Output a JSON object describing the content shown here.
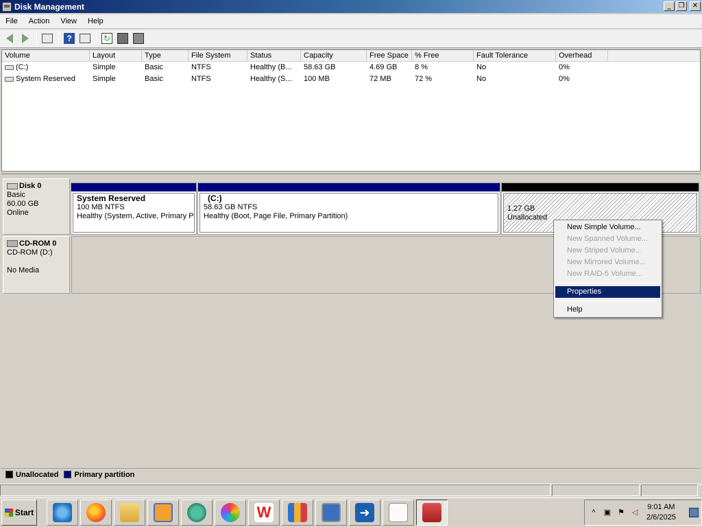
{
  "window": {
    "title": "Disk Management"
  },
  "menu": [
    "File",
    "Action",
    "View",
    "Help"
  ],
  "toolbar": {
    "buttons": [
      "back-arrow-icon",
      "forward-arrow-icon",
      "show-hide-console-tree-icon",
      "help-icon",
      "export-list-icon",
      "refresh-icon",
      "properties-icon",
      "disk-ops-icon"
    ]
  },
  "volume_list": {
    "columns": [
      "Volume",
      "Layout",
      "Type",
      "File System",
      "Status",
      "Capacity",
      "Free Space",
      "% Free",
      "Fault Tolerance",
      "Overhead"
    ],
    "rows": [
      [
        "(C:)",
        "Simple",
        "Basic",
        "NTFS",
        "Healthy (B...",
        "58.63 GB",
        "4.69 GB",
        "8 %",
        "No",
        "0%"
      ],
      [
        "System Reserved",
        "Simple",
        "Basic",
        "NTFS",
        "Healthy (S...",
        "100 MB",
        "72 MB",
        "72 %",
        "No",
        "0%"
      ]
    ]
  },
  "disks": {
    "disk0": {
      "name": "Disk 0",
      "type": "Basic",
      "size": "60.00 GB",
      "state": "Online",
      "partitions": [
        {
          "name": "System Reserved",
          "size": "100 MB NTFS",
          "status": "Healthy (System, Active, Primary Partition)",
          "kind": "primary"
        },
        {
          "name": "(C:)",
          "size": "58.63 GB NTFS",
          "status": "Healthy (Boot, Page File, Primary Partition)",
          "kind": "primary"
        },
        {
          "name": "",
          "size": "1.27 GB",
          "status": "Unallocated",
          "kind": "unallocated"
        }
      ]
    },
    "cdrom0": {
      "name": "CD-ROM 0",
      "type": "CD-ROM (D:)",
      "state": "No Media"
    }
  },
  "context_menu": {
    "items": [
      {
        "label": "New Simple Volume...",
        "enabled": true
      },
      {
        "label": "New Spanned Volume...",
        "enabled": false
      },
      {
        "label": "New Striped Volume...",
        "enabled": false
      },
      {
        "label": "New Mirrored Volume...",
        "enabled": false
      },
      {
        "label": "New RAID-5 Volume...",
        "enabled": false
      },
      {
        "label": "Properties",
        "enabled": true,
        "selected": true
      },
      {
        "label": "Help",
        "enabled": true
      }
    ]
  },
  "legend": [
    {
      "label": "Unallocated",
      "color": "#000000"
    },
    {
      "label": "Primary partition",
      "color": "#000080"
    }
  ],
  "taskbar": {
    "start_label": "Start",
    "apps": [
      "internet-explorer-icon",
      "firefox-icon",
      "file-explorer-icon",
      "media-player-icon",
      "chat-app-icon",
      "color-wheel-app-icon",
      "wps-office-icon",
      "archive-app-icon",
      "network-computer-icon",
      "remote-transfer-icon",
      "notepad-icon",
      "toolbox-app-icon"
    ],
    "clock_time": "9:01 AM",
    "clock_date": "2/6/2025"
  },
  "colors": {
    "primary_partition": "#000080",
    "unallocated": "#000000",
    "selection": "#0a246a"
  }
}
